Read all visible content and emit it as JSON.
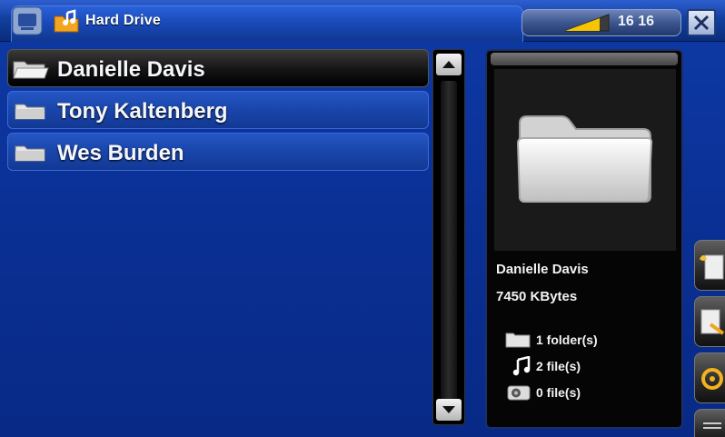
{
  "window": {
    "title": "Hard Drive",
    "clock": "16 16"
  },
  "file_list": {
    "items": [
      {
        "label": "Danielle Davis",
        "selected": true
      },
      {
        "label": "Tony Kaltenberg",
        "selected": false
      },
      {
        "label": "Wes Burden",
        "selected": false
      }
    ]
  },
  "info_panel": {
    "name": "Danielle Davis",
    "size": "7450 KBytes",
    "folders": "1 folder(s)",
    "music_files": "2 file(s)",
    "video_files": "0 file(s)"
  },
  "icons": {
    "app_menu": "app-menu-icon",
    "title": "music-folder-icon",
    "battery": "battery-level-icon",
    "close": "close-icon",
    "folder": "folder-icon",
    "music": "music-note-icon",
    "video": "video-icon",
    "side_actions": [
      "add-bookmark-icon",
      "edit-file-icon",
      "settings-icon",
      "menu-icon"
    ]
  },
  "colors": {
    "background": "#0a2f93",
    "selected_row": "#141414",
    "row": "#1a47ad"
  }
}
